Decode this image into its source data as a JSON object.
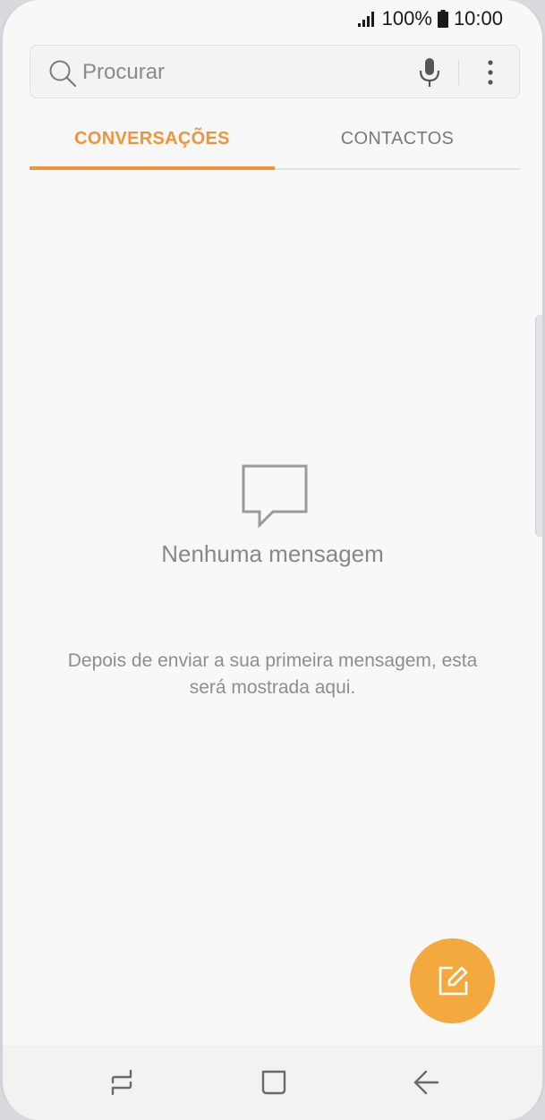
{
  "status_bar": {
    "battery_percent": "100%",
    "time": "10:00",
    "icons": [
      "signal-icon",
      "battery-icon"
    ]
  },
  "search": {
    "placeholder": "Procurar",
    "value": "",
    "icons": [
      "search-icon",
      "microphone-icon",
      "more-vertical-icon"
    ]
  },
  "tabs": [
    {
      "label": "CONVERSAÇÕES",
      "active": true
    },
    {
      "label": "CONTACTOS",
      "active": false
    }
  ],
  "empty_state": {
    "icon": "message-bubble-icon",
    "title": "Nenhuma mensagem",
    "description": "Depois de enviar a sua primeira mensagem, esta será mostrada aqui."
  },
  "fab": {
    "icon": "compose-icon"
  },
  "nav_bar": {
    "icons": [
      "recents-icon",
      "home-icon",
      "back-icon"
    ]
  },
  "colors": {
    "accent": "#f0943a",
    "fab": "#f4a93f",
    "background": "#f8f8f8"
  }
}
